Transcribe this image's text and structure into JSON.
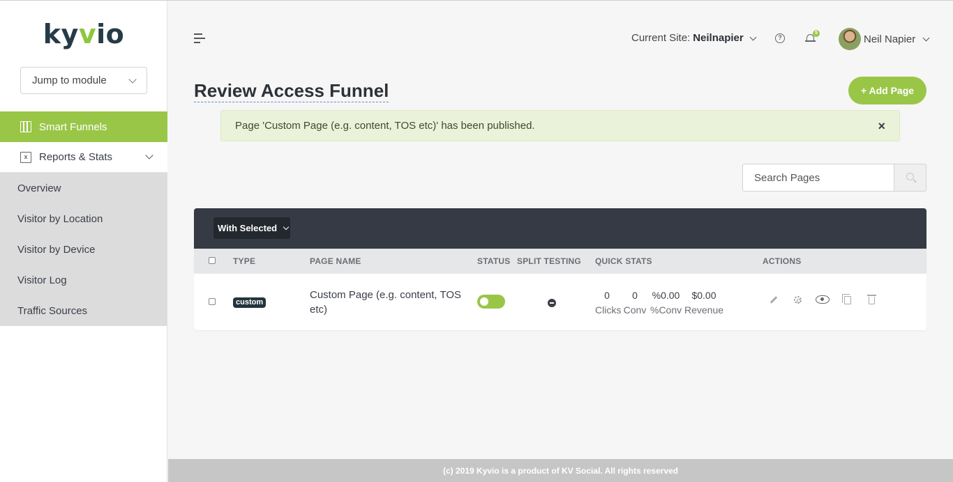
{
  "logo": {
    "text_main": "ky",
    "text_accent": "v",
    "text_end": "io"
  },
  "sidebar": {
    "jump_label": "Jump to module",
    "active_item": "Smart Funnels",
    "reports_label": "Reports & Stats",
    "sub_items": [
      "Overview",
      "Visitor by Location",
      "Visitor by Device",
      "Visitor Log",
      "Traffic Sources"
    ]
  },
  "header": {
    "site_label": "Current Site:",
    "site_value": "Neilnapier",
    "help_glyph": "?",
    "notif_count": "5",
    "user_name": "Neil Napier"
  },
  "main": {
    "title": "Review Access Funnel",
    "add_button": "+ Add Page",
    "alert_text": "Page 'Custom Page (e.g. content, TOS etc)' has been published.",
    "alert_close": "×",
    "search_placeholder": "Search Pages"
  },
  "table": {
    "with_selected": "With Selected",
    "columns": {
      "type": "TYPE",
      "page_name": "PAGE NAME",
      "status": "STATUS",
      "split": "SPLIT TESTING",
      "quick_stats": "QUICK STATS",
      "actions": "ACTIONS"
    },
    "rows": [
      {
        "type": "custom",
        "page_name": "Custom Page (e.g. content, TOS etc)",
        "status_on": true,
        "stats": [
          {
            "value": "0",
            "label": "Clicks"
          },
          {
            "value": "0",
            "label": "Conv"
          },
          {
            "value": "%0.00",
            "label": "%Conv"
          },
          {
            "value": "$0.00",
            "label": "Revenue"
          }
        ]
      }
    ]
  },
  "footer": {
    "text": "(c) 2019 Kyvio is a product of KV Social. All rights reserved"
  },
  "colors": {
    "accent": "#9ac648",
    "dark": "#353a44",
    "brand_dark": "#263b47"
  }
}
